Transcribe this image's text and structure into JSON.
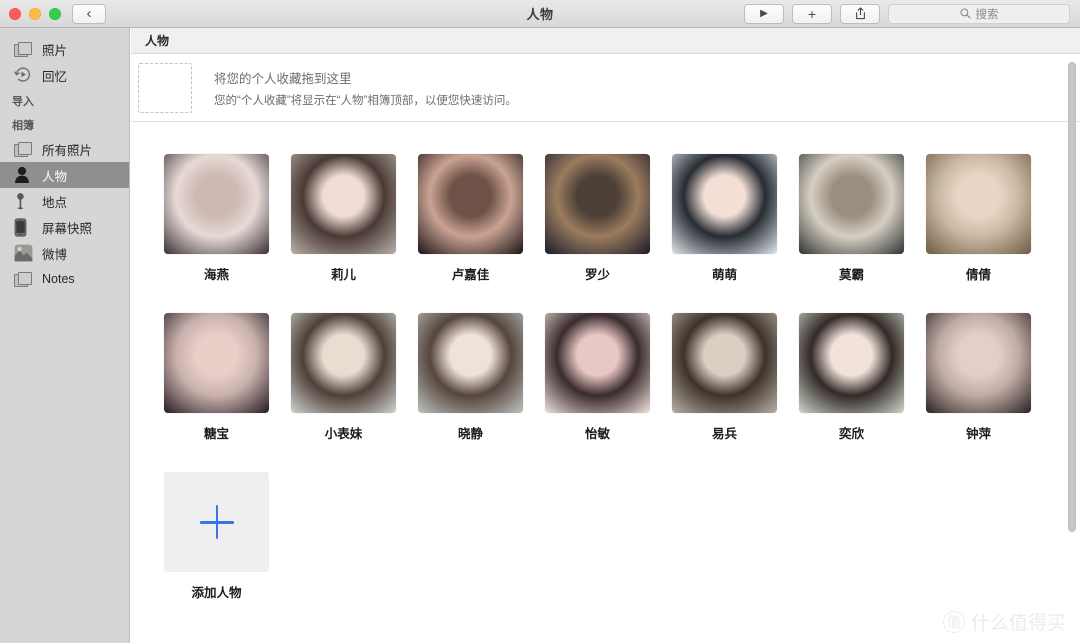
{
  "window": {
    "title": "人物",
    "traffic_lights": [
      "close",
      "minimize",
      "zoom"
    ],
    "back_label": "‹"
  },
  "toolbar": {
    "play_icon": "play-icon",
    "play_glyph": "▶",
    "add_icon": "plus-icon",
    "add_glyph": "+",
    "share_icon": "share-icon",
    "share_glyph": "↥",
    "search_placeholder": "搜索",
    "search_value": "",
    "search_icon": "search-icon"
  },
  "sidebar": {
    "items": [
      {
        "label": "照片",
        "icon": "photos-icon",
        "selected": false
      },
      {
        "label": "回忆",
        "icon": "memories-icon",
        "selected": false
      }
    ],
    "section_import": "导入",
    "section_albums": "相簿",
    "albums": [
      {
        "label": "所有照片",
        "icon": "album-icon",
        "selected": false
      },
      {
        "label": "人物",
        "icon": "person-icon",
        "selected": true
      },
      {
        "label": "地点",
        "icon": "location-pin-icon",
        "selected": false
      },
      {
        "label": "屏幕快照",
        "icon": "phone-icon",
        "selected": false
      },
      {
        "label": "微博",
        "icon": "photo-thumbnail-icon",
        "selected": false
      },
      {
        "label": "Notes",
        "icon": "album-icon",
        "selected": false
      }
    ]
  },
  "content": {
    "header_title": "人物",
    "dropzone": {
      "title": "将您的个人收藏拖到这里",
      "subtitle": "您的“个人收藏”将显示在“人物”相簿顶部，以便您快速访问。"
    },
    "people": [
      {
        "name": "海燕",
        "c1": "#3a3036",
        "c2": "#cdb8b2",
        "c3": "#e7dad6"
      },
      {
        "name": "莉儿",
        "c1": "#b9b0aa",
        "c2": "#f0dcd4",
        "c3": "#4a3a35"
      },
      {
        "name": "卢嘉佳",
        "c1": "#1b1418",
        "c2": "#6e5248",
        "c3": "#caa392"
      },
      {
        "name": "罗少",
        "c1": "#1b1a2b",
        "c2": "#4d4037",
        "c3": "#9a7c5e"
      },
      {
        "name": "萌萌",
        "c1": "#dfe6ea",
        "c2": "#f3dfd6",
        "c3": "#272c33"
      },
      {
        "name": "莫霸",
        "c1": "#30332f",
        "c2": "#9b8f7f",
        "c3": "#d6cfc4"
      },
      {
        "name": "倩倩",
        "c1": "#6e5c44",
        "c2": "#ead6c6",
        "c3": "#c9b8a2"
      },
      {
        "name": "糖宝",
        "c1": "#261b22",
        "c2": "#e9cfc8",
        "c3": "#c8b0ac"
      },
      {
        "name": "小表妹",
        "c1": "#cfd3d0",
        "c2": "#e9ddd2",
        "c3": "#4f4038"
      },
      {
        "name": "晓静",
        "c1": "#bfc3c0",
        "c2": "#efe2d8",
        "c3": "#55463d"
      },
      {
        "name": "怡敏",
        "c1": "#f0e2de",
        "c2": "#e8c8c4",
        "c3": "#3a2b2d"
      },
      {
        "name": "易兵",
        "c1": "#b9b0a4",
        "c2": "#d9cfc2",
        "c3": "#3d332c"
      },
      {
        "name": "奕欣",
        "c1": "#cfd8cc",
        "c2": "#f1e3da",
        "c3": "#332a28"
      },
      {
        "name": "钟萍",
        "c1": "#2a2222",
        "c2": "#e3cfc8",
        "c3": "#bfaaa4"
      }
    ],
    "add_person": {
      "label": "添加人物",
      "icon": "plus-icon",
      "accent": "#3a74e8"
    }
  },
  "watermark": {
    "badge": "值",
    "text": "什么值得买"
  },
  "colors": {
    "sidebar_bg": "#d6d6d6",
    "selection": "#8f8f8f",
    "accent": "#3a74e8",
    "titlebar": "#e0e0e0"
  }
}
